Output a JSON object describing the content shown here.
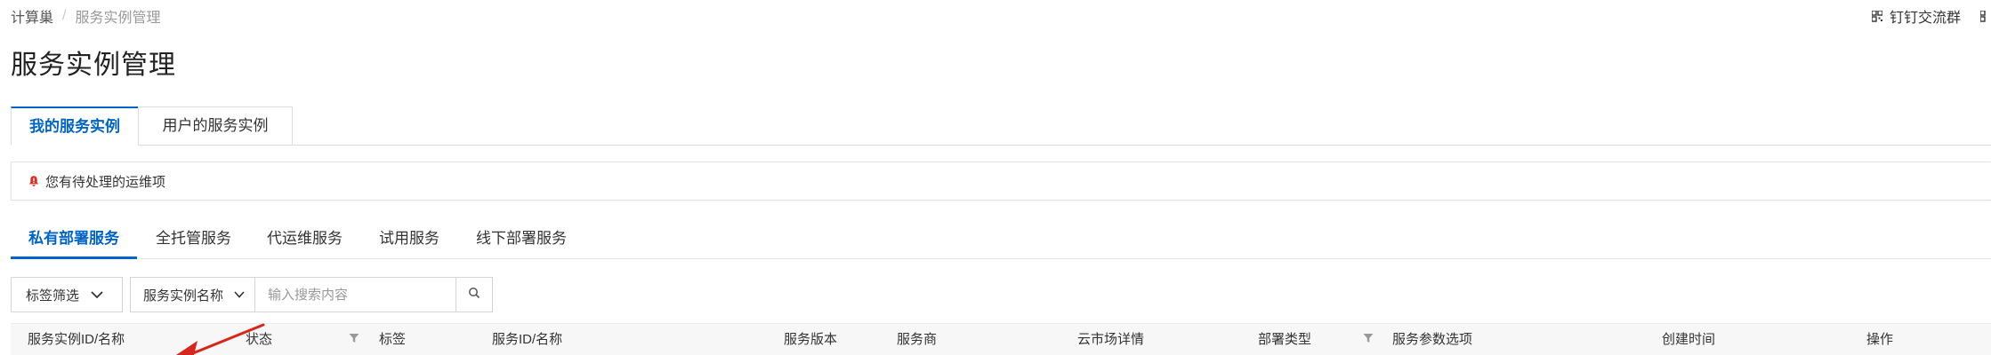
{
  "breadcrumb": {
    "root": "计算巢",
    "separator": "/",
    "current": "服务实例管理"
  },
  "topright": {
    "dingtalk_label": "钉钉交流群"
  },
  "page": {
    "title": "服务实例管理"
  },
  "instance_tabs": [
    {
      "label": "我的服务实例",
      "active": true
    },
    {
      "label": "用户的服务实例",
      "active": false
    }
  ],
  "alert": {
    "text": "您有待处理的运维项",
    "icon": "bell-icon",
    "icon_color": "#d93026"
  },
  "service_tabs": [
    {
      "label": "私有部署服务",
      "active": true
    },
    {
      "label": "全托管服务",
      "active": false
    },
    {
      "label": "代运维服务",
      "active": false
    },
    {
      "label": "试用服务",
      "active": false
    },
    {
      "label": "线下部署服务",
      "active": false
    }
  ],
  "toolbar": {
    "tag_filter_label": "标签筛选",
    "search_field_label": "服务实例名称",
    "search_placeholder": "输入搜索内容"
  },
  "table": {
    "columns": [
      {
        "label": "服务实例ID/名称",
        "filter": false
      },
      {
        "label": "状态",
        "filter": true
      },
      {
        "label": "标签",
        "filter": false
      },
      {
        "label": "服务ID/名称",
        "filter": false
      },
      {
        "label": "服务版本",
        "filter": false
      },
      {
        "label": "服务商",
        "filter": false
      },
      {
        "label": "云市场详情",
        "filter": false
      },
      {
        "label": "部署类型",
        "filter": true
      },
      {
        "label": "服务参数选项",
        "filter": false
      },
      {
        "label": "创建时间",
        "filter": false
      },
      {
        "label": "操作",
        "filter": false
      }
    ]
  },
  "colors": {
    "accent": "#0064c8",
    "annotation_arrow": "#d9261c"
  }
}
